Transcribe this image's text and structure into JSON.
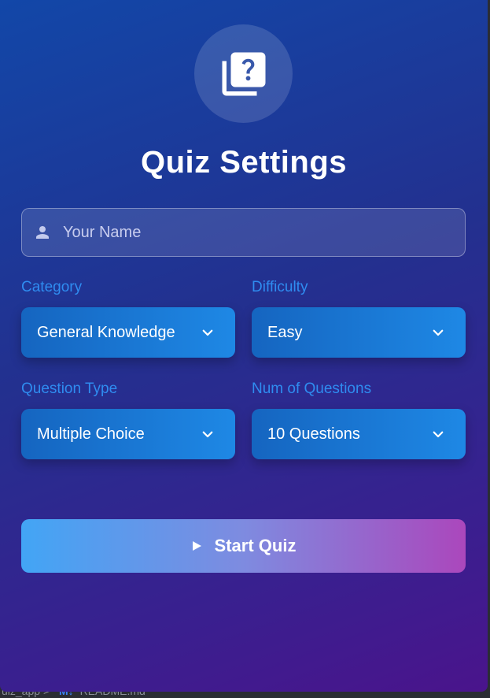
{
  "background": {
    "path_segment": "uiz_app",
    "separator": ">",
    "file_type_badge": "M↓",
    "file_name": "README.md"
  },
  "logo": {
    "icon": "quiz-icon"
  },
  "title": "Quiz Settings",
  "name_field": {
    "placeholder": "Your Name",
    "value": "",
    "icon": "person-icon"
  },
  "fields": {
    "category": {
      "label": "Category",
      "value": "General Knowledge"
    },
    "difficulty": {
      "label": "Difficulty",
      "value": "Easy"
    },
    "question_type": {
      "label": "Question Type",
      "value": "Multiple Choice"
    },
    "num_questions": {
      "label": "Num of Questions",
      "value": "10 Questions"
    }
  },
  "start_button": {
    "label": "Start Quiz",
    "icon": "play-icon"
  },
  "colors": {
    "label": "#2f8cf0",
    "select_start": "#1565c0",
    "select_end": "#1e88e5",
    "button_start": "#42a5f5",
    "button_end": "#ab47bc"
  }
}
